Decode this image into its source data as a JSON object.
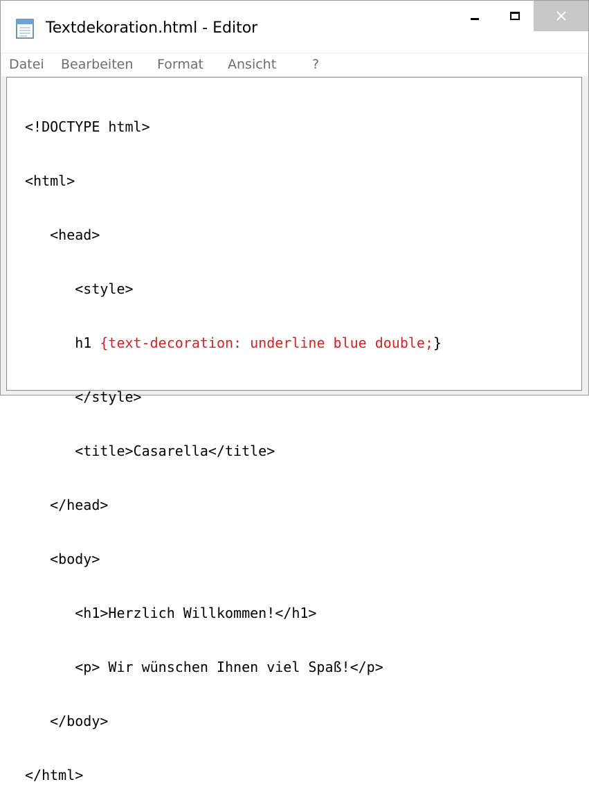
{
  "window": {
    "title": "Textdekoration.html - Editor",
    "controls": {
      "minimize": "minimize",
      "maximize": "maximize",
      "close": "✕"
    }
  },
  "menu": [
    "Datei",
    "Bearbeiten",
    "Format",
    "Ansicht",
    "?"
  ],
  "code": {
    "line1": "<!DOCTYPE html>",
    "line2": "<html>",
    "line3": "   <head>",
    "line4": "      <style>",
    "line5_prefix": "      h1 ",
    "line5_red": "{text-decoration: underline blue double;",
    "line5_suffix": "}",
    "line6": "      </style>",
    "line7": "      <title>Casarella</title>",
    "line8": "   </head>",
    "line9": "   <body>",
    "line10": "      <h1>Herzlich Willkommen!</h1>",
    "line11": "      <p> Wir wünschen Ihnen viel Spaß!</p>",
    "line12": "   </body>",
    "line13": "</html>"
  },
  "colors": {
    "highlight": "#e02020",
    "close_button_bg": "#c7c7c7",
    "menu_text": "#6d6d6d"
  },
  "icons": {
    "app": "notepad-icon"
  }
}
